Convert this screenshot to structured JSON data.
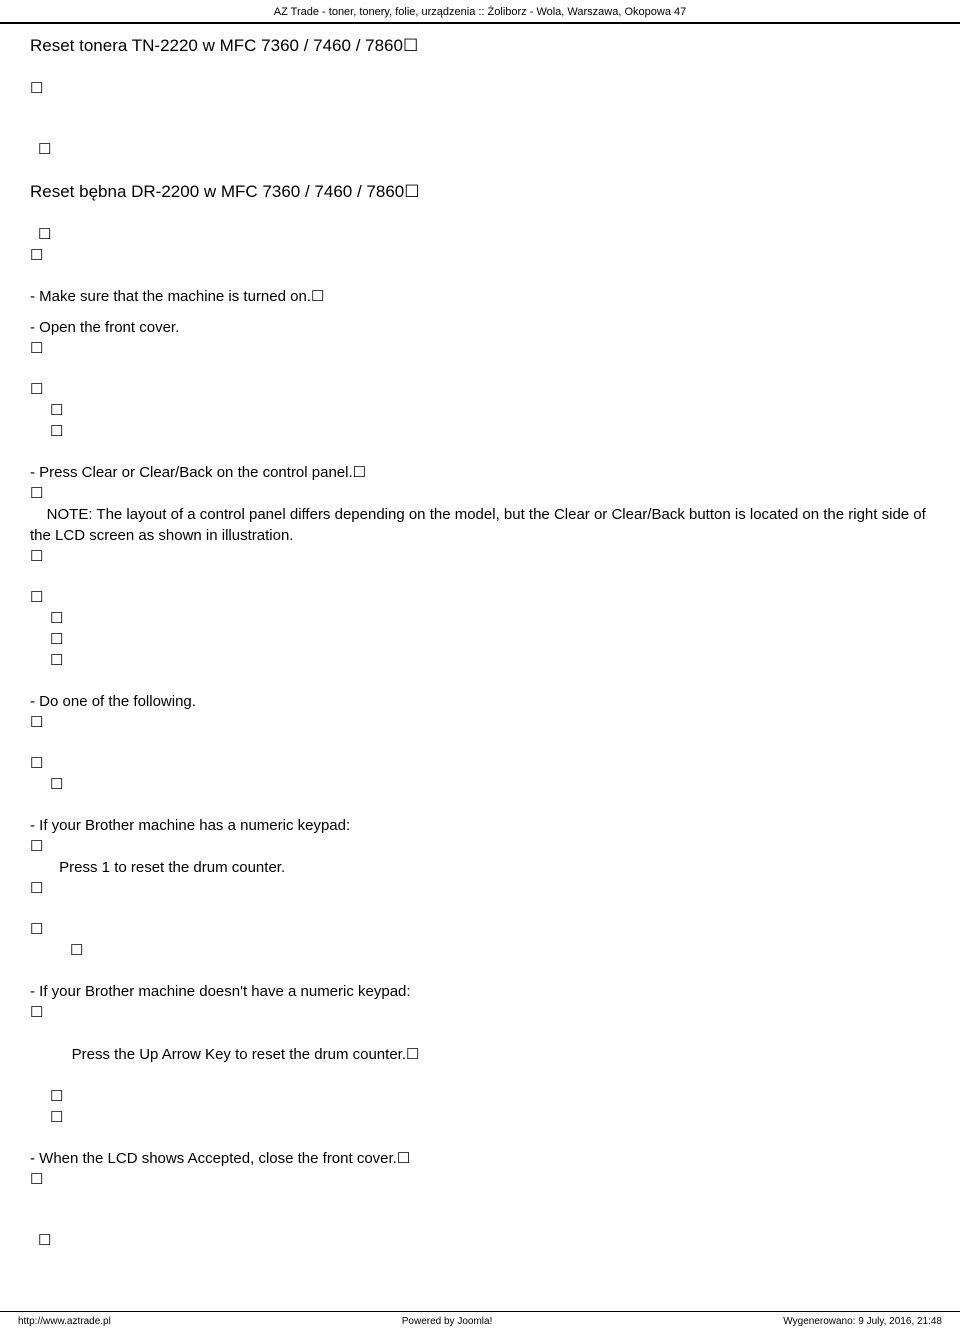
{
  "glyph": "☐",
  "header": {
    "title": "AZ Trade - toner, tonery, folie, urządzenia :: Żoliborz - Wola, Warszawa, Okopowa 47"
  },
  "body": {
    "heading1": "Reset tonera TN-2220 w MFC 7360 / 7460 / 7860",
    "heading2": "Reset bębna DR-2200 w MFC 7360 / 7460 / 7860",
    "step1": " - Make sure that the machine is turned on.",
    "step2": " - Open the front cover.",
    "step3": " - Press Clear or Clear/Back on the control panel.",
    "note": "    NOTE: The layout of a control panel differs depending on the model, but the Clear or Clear/Back button is located on the right side of the LCD screen as shown in illustration.",
    "step4": " - Do one of the following.",
    "step5": " - If your Brother machine has a numeric keypad:",
    "step5a": "       Press 1 to reset the drum counter.",
    "step6": " - If your Brother machine doesn't have a numeric keypad:",
    "step6a": "      Press the Up Arrow Key to reset the drum counter.",
    "step7": " - When the LCD shows Accepted, close the front cover."
  },
  "footer": {
    "left": "http://www.aztrade.pl",
    "center": "Powered by Joomla!",
    "right": "Wygenerowano: 9 July, 2016, 21:48"
  }
}
